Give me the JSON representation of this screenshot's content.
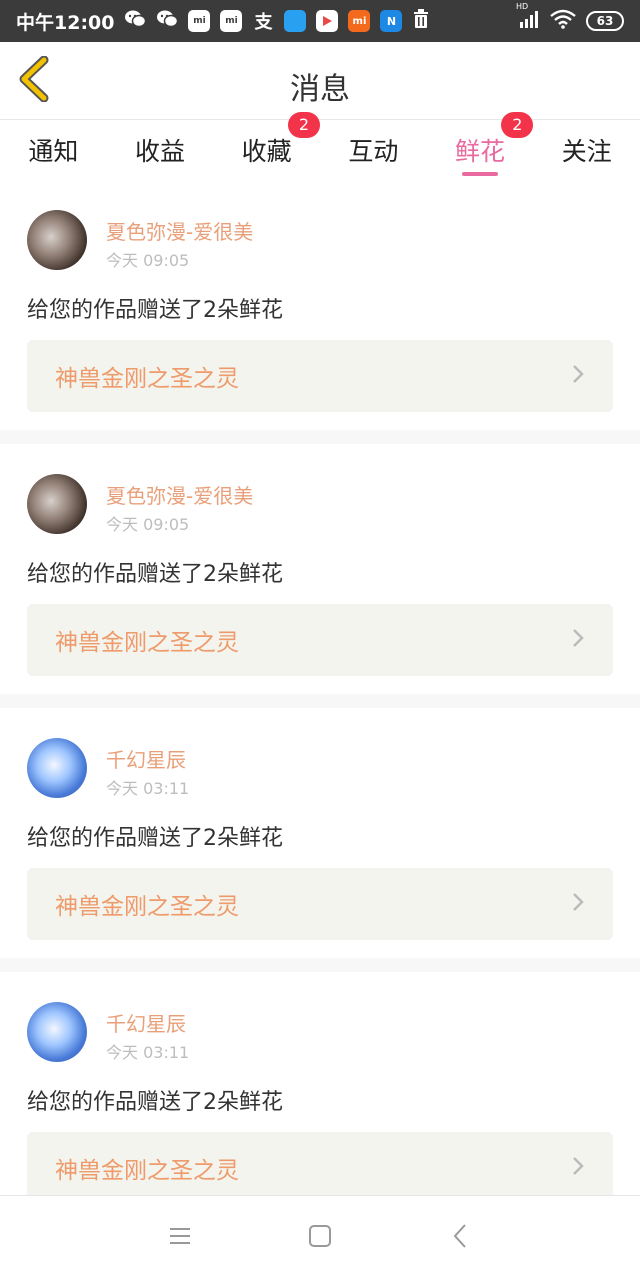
{
  "status_bar": {
    "time": "中午12:00",
    "battery": "63",
    "network": "HD",
    "icons": [
      "wechat-icon",
      "wechat-icon",
      "mi-store-icon",
      "mi-store-icon",
      "alipay-icon",
      "app-icon",
      "play-icon",
      "mi-icon",
      "n-app-icon",
      "trash-icon"
    ]
  },
  "header": {
    "title": "消息"
  },
  "tabs": [
    {
      "label": "通知",
      "active": false,
      "badge": ""
    },
    {
      "label": "收益",
      "active": false,
      "badge": ""
    },
    {
      "label": "收藏",
      "active": false,
      "badge": "2"
    },
    {
      "label": "互动",
      "active": false,
      "badge": ""
    },
    {
      "label": "鲜花",
      "active": true,
      "badge": "2"
    },
    {
      "label": "关注",
      "active": false,
      "badge": ""
    }
  ],
  "feed": [
    {
      "user": "夏色弥漫-爱很美",
      "time": "今天 09:05",
      "message": "给您的作品赠送了2朵鲜花",
      "work": "神兽金刚之圣之灵"
    },
    {
      "user": "夏色弥漫-爱很美",
      "time": "今天 09:05",
      "message": "给您的作品赠送了2朵鲜花",
      "work": "神兽金刚之圣之灵"
    },
    {
      "user": "千幻星辰",
      "time": "今天 03:11",
      "message": "给您的作品赠送了2朵鲜花",
      "work": "神兽金刚之圣之灵"
    },
    {
      "user": "千幻星辰",
      "time": "今天 03:11",
      "message": "给您的作品赠送了2朵鲜花",
      "work": "神兽金刚之圣之灵"
    }
  ],
  "colors": {
    "accent": "#e86aa0",
    "badge": "#f2334a",
    "username": "#e9a07a",
    "work_title": "#ee9a6b",
    "back_arrow": "#f2c200"
  }
}
